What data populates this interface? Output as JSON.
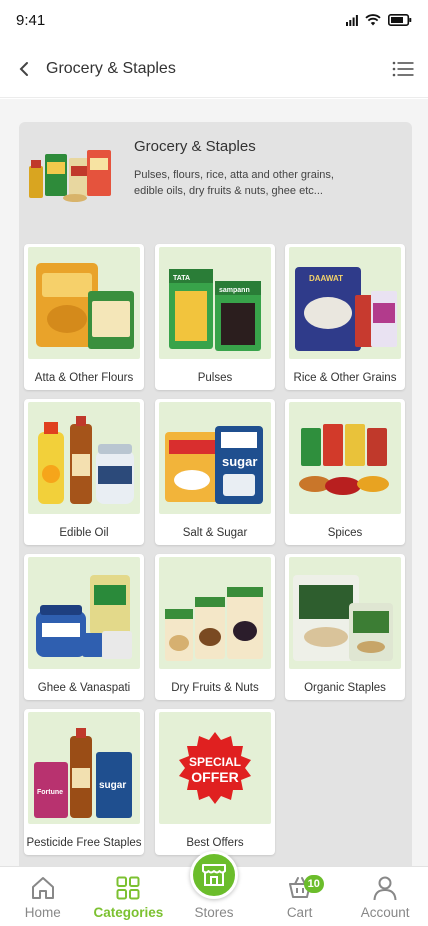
{
  "status_bar": {
    "time": "9:41"
  },
  "header": {
    "title": "Grocery & Staples"
  },
  "category": {
    "title": "Grocery & Staples",
    "description": "Pulses, flours, rice, atta and other grains, edible oils, dry fruits & nuts, ghee etc..."
  },
  "tiles": [
    {
      "label": "Atta & Other Flours"
    },
    {
      "label": "Pulses"
    },
    {
      "label": "Rice & Other Grains"
    },
    {
      "label": "Edible Oil"
    },
    {
      "label": "Salt & Sugar"
    },
    {
      "label": "Spices"
    },
    {
      "label": "Ghee & Vanaspati"
    },
    {
      "label": "Dry Fruits & Nuts"
    },
    {
      "label": "Organic Staples"
    },
    {
      "label": "Pesticide Free Staples"
    },
    {
      "label": "Best Offers"
    }
  ],
  "tile_images": {
    "pulses_brand": "TATA",
    "pulses_sub": "sampann",
    "rice_brand": "DAAWAT",
    "salt_sugar_brand": "sugar",
    "pesticide_sugar": "sugar",
    "fortune_brand": "Fortune",
    "best_offer_line1": "SPECIAL",
    "best_offer_line2": "OFFER"
  },
  "bottom_nav": {
    "home": "Home",
    "categories": "Categories",
    "stores": "Stores",
    "cart": "Cart",
    "cart_count": "10",
    "account": "Account"
  },
  "colors": {
    "accent": "#7cc131",
    "tile_bg": "#e4f0d6",
    "panel_bg": "#e3e3e3",
    "offer_red": "#e02020"
  }
}
